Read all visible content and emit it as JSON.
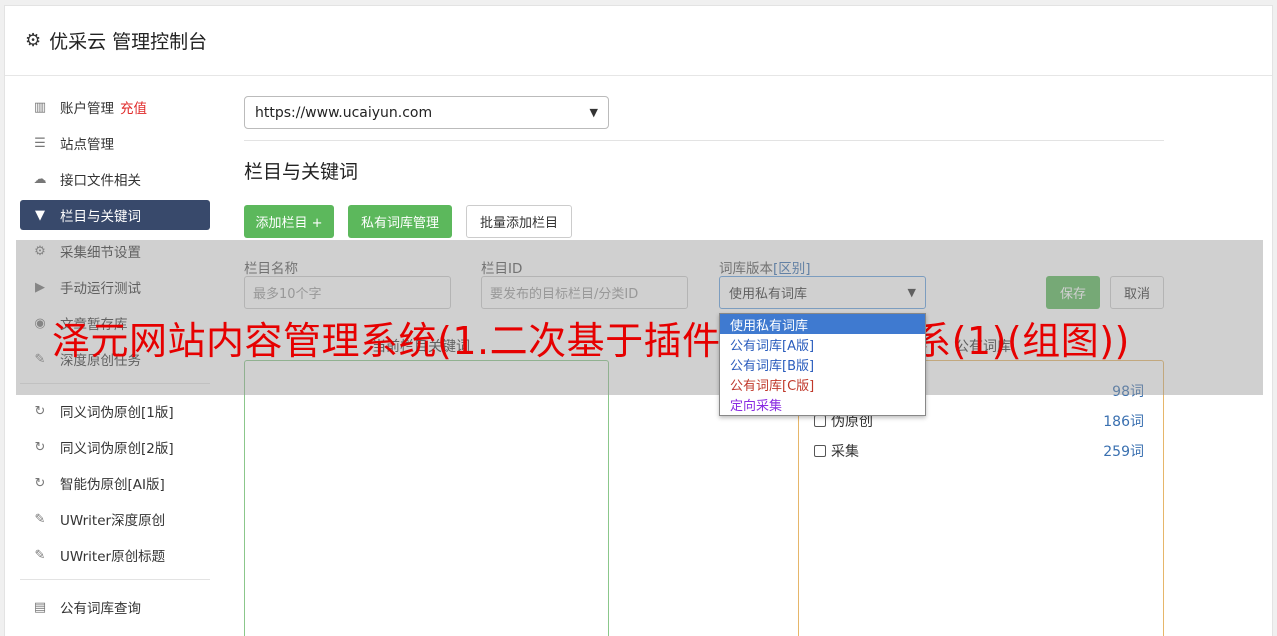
{
  "header": {
    "title": "优采云 管理控制台",
    "icon": "gear-icon"
  },
  "sidebar": {
    "items": [
      {
        "label": "账户管理",
        "extra": "充值",
        "icon": "bar-chart-icon"
      },
      {
        "label": "站点管理",
        "icon": "server-icon"
      },
      {
        "label": "接口文件相关",
        "icon": "cloud-upload-icon"
      },
      {
        "label": "栏目与关键词",
        "icon": "filter-icon",
        "active": true
      },
      {
        "label": "采集细节设置",
        "icon": "cogs-icon"
      },
      {
        "label": "手动运行测试",
        "icon": "play-circle-icon"
      },
      {
        "label": "文章暂存库",
        "icon": "database-icon"
      },
      {
        "label": "深度原创任务",
        "icon": "edit-icon"
      }
    ],
    "items2": [
      {
        "label": "同义词伪原创[1版]",
        "icon": "refresh-icon"
      },
      {
        "label": "同义词伪原创[2版]",
        "icon": "refresh-icon"
      },
      {
        "label": "智能伪原创[AI版]",
        "icon": "refresh-icon"
      },
      {
        "label": "UWriter深度原创",
        "icon": "edit-icon"
      },
      {
        "label": "UWriter原创标题",
        "icon": "edit-icon"
      }
    ],
    "items3": [
      {
        "label": "公有词库查询",
        "icon": "book-icon"
      }
    ]
  },
  "main": {
    "site_select": "https://www.ucaiyun.com",
    "section_title": "栏目与关键词",
    "buttons": {
      "add_column": "添加栏目 +",
      "private_lexicon": "私有词库管理",
      "batch_add": "批量添加栏目"
    },
    "form": {
      "name_label": "栏目名称",
      "name_placeholder": "最多10个字",
      "id_label": "栏目ID",
      "id_placeholder": "要发布的目标栏目/分类ID",
      "version_label": "词库版本",
      "version_label_extra": "[区别]",
      "version_value": "使用私有词库",
      "save": "保存",
      "cancel": "取消"
    },
    "dropdown_options": [
      {
        "label": "使用私有词库",
        "style": "sel"
      },
      {
        "label": "公有词库[A版]",
        "style": "blue"
      },
      {
        "label": "公有词库[B版]",
        "style": "blue"
      },
      {
        "label": "公有词库[C版]",
        "style": "red"
      },
      {
        "label": "定向采集",
        "style": "purple"
      }
    ],
    "panel_left_title": "当前栏目关键词",
    "panel_right_title": "公有词库",
    "lexicon_rows": [
      {
        "label": "原创",
        "count": "98词"
      },
      {
        "label": "伪原创",
        "count": "186词"
      },
      {
        "label": "采集",
        "count": "259词"
      }
    ]
  },
  "banner": {
    "headline": "泽元网站内容管理系统(1.二次基于插件的松耦合体系(1)(组图))"
  },
  "colors": {
    "accent_green": "#5cb85c",
    "active_nav": "#38496b",
    "headline_red": "#e60000"
  }
}
